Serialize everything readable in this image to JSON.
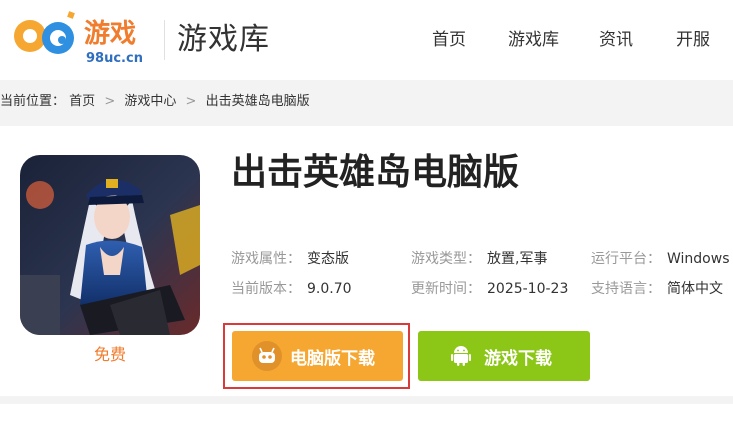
{
  "header": {
    "logo_text": "游戏",
    "logo_number": "98",
    "logo_domain": "98uc.cn",
    "section_title": "游戏库",
    "nav": [
      "首页",
      "游戏库",
      "资讯",
      "开服"
    ]
  },
  "breadcrumb": {
    "label": "当前位置：",
    "items": [
      "首页",
      "游戏中心",
      "出击英雄岛电脑版"
    ],
    "separator": ">"
  },
  "game": {
    "title": "出击英雄岛电脑版",
    "price_label": "免费",
    "info": {
      "attr_label": "游戏属性：",
      "attr_value": "变态版",
      "type_label": "游戏类型：",
      "type_value": "放置,军事",
      "platform_label": "运行平台：",
      "platform_value": "Windows",
      "version_label": "当前版本：",
      "version_value": "9.0.70",
      "update_label": "更新时间：",
      "update_value": "2025-10-23",
      "lang_label": "支持语言：",
      "lang_value": "简体中文"
    }
  },
  "buttons": {
    "pc_download": "电脑版下载",
    "game_download": "游戏下载"
  },
  "colors": {
    "pc_button": "#f5a732",
    "game_button": "#8cc616",
    "highlight": "#d93a3a",
    "free": "#f07c2d"
  }
}
